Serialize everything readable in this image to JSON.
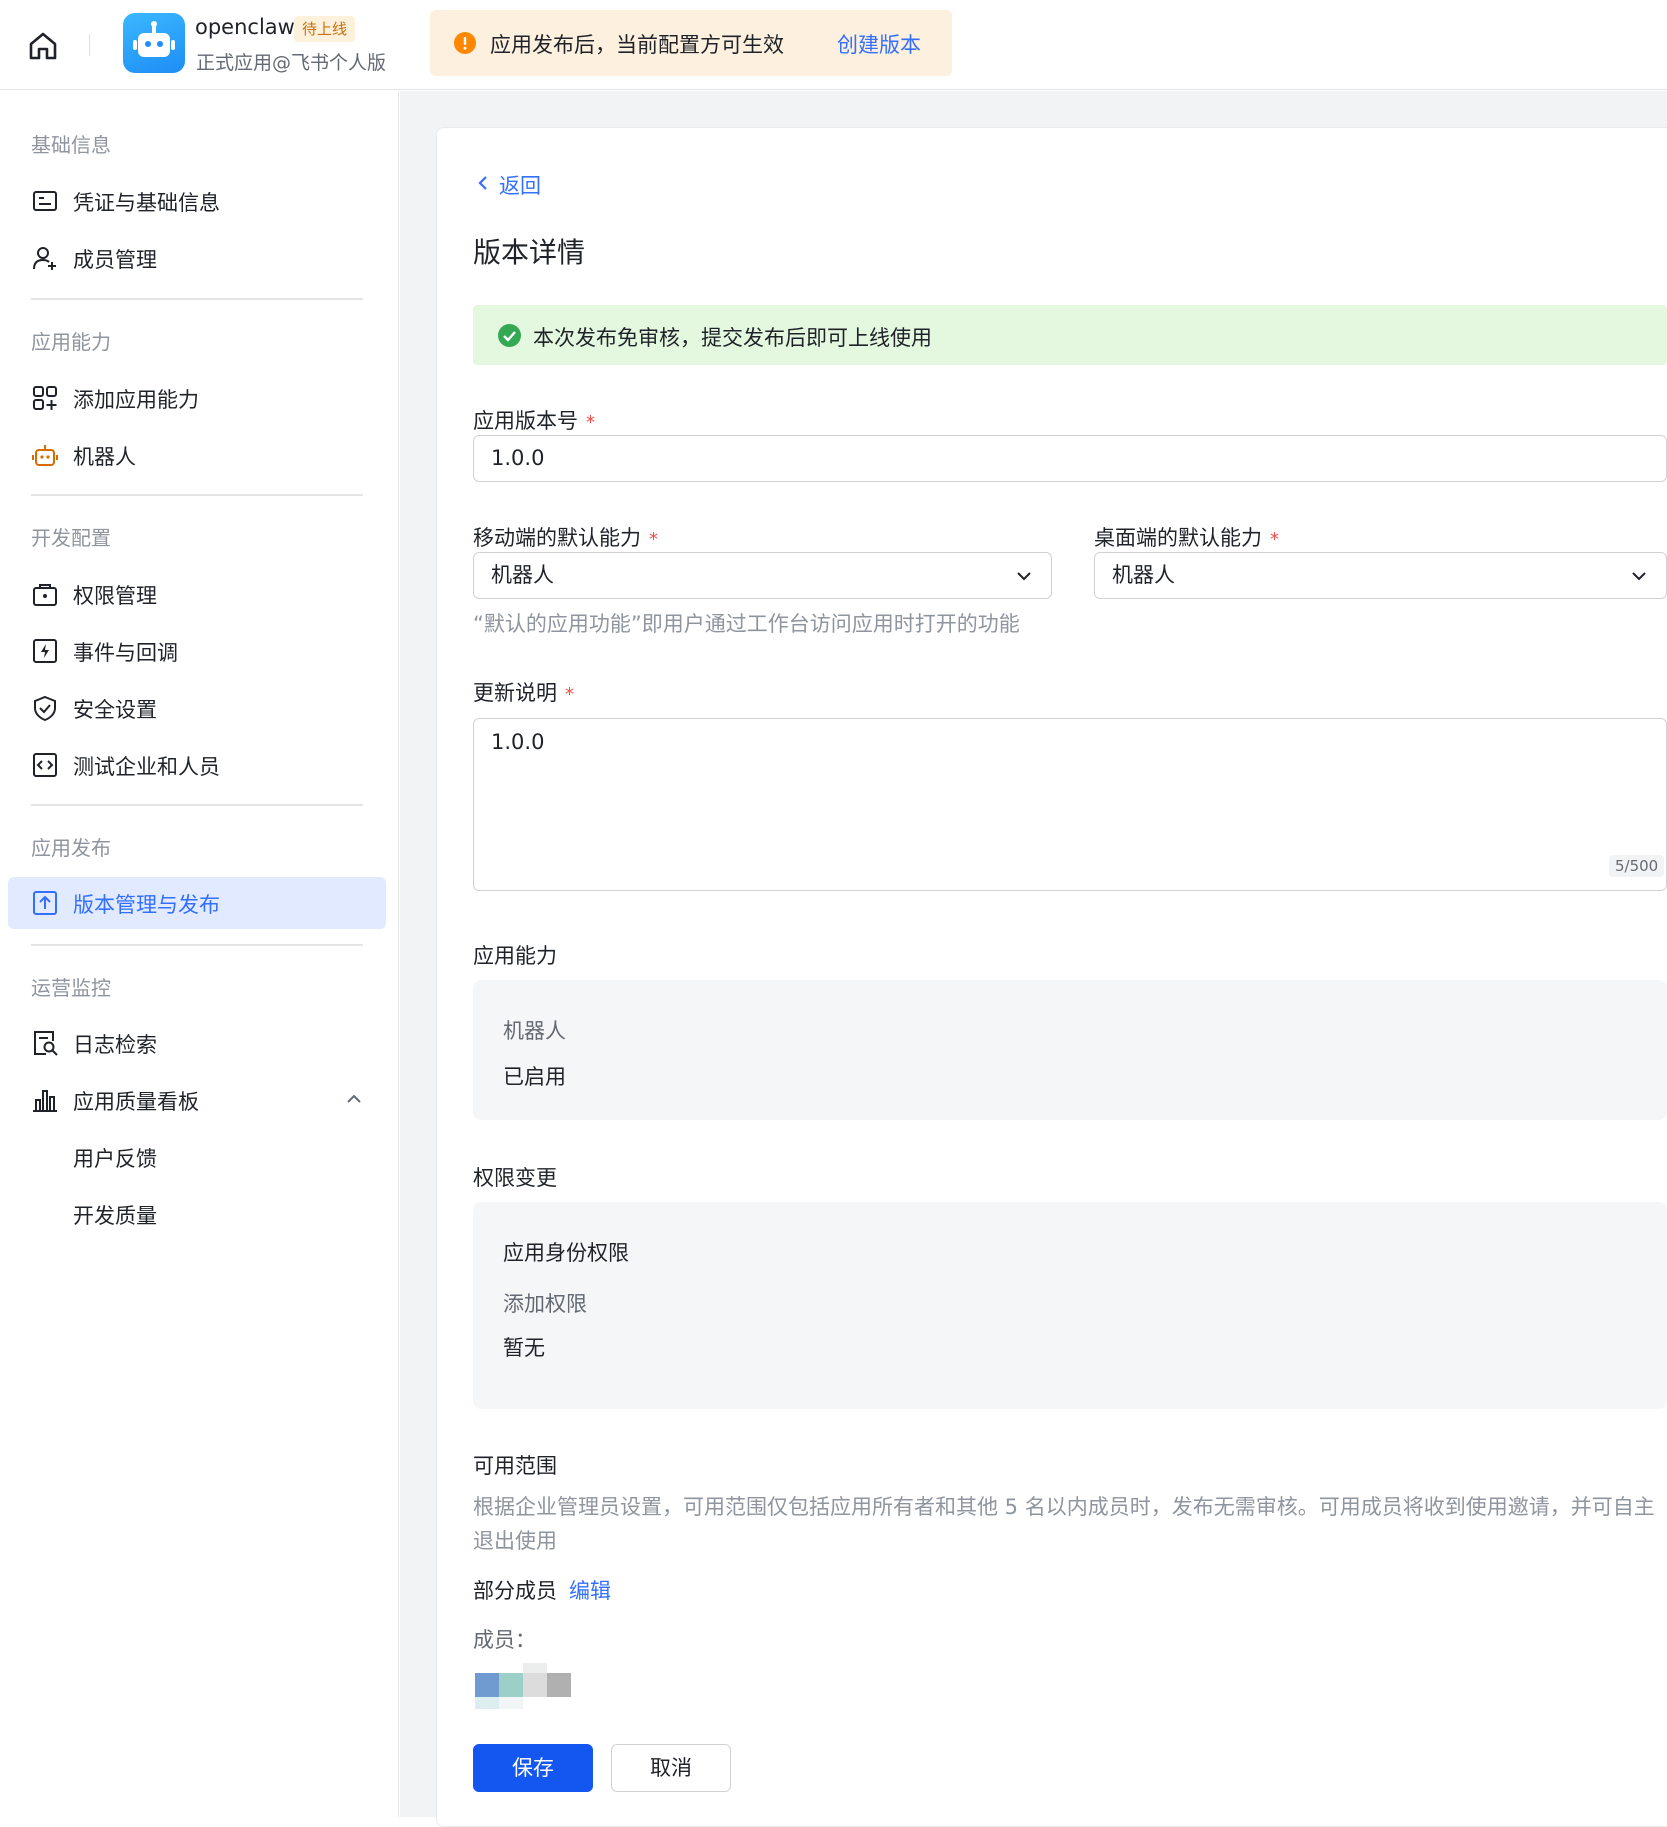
{
  "header": {
    "app_name": "openclaw",
    "status_badge": "待上线",
    "app_subtitle": "正式应用@飞书个人版",
    "notice_text": "应用发布后，当前配置方可生效",
    "notice_link": "创建版本"
  },
  "sidebar": {
    "sections": [
      {
        "title": "基础信息",
        "items": [
          {
            "label": "凭证与基础信息",
            "icon": "id-card-icon"
          },
          {
            "label": "成员管理",
            "icon": "add-user-icon"
          }
        ]
      },
      {
        "title": "应用能力",
        "items": [
          {
            "label": "添加应用能力",
            "icon": "apps-add-icon"
          },
          {
            "label": "机器人",
            "icon": "robot-icon"
          }
        ]
      },
      {
        "title": "开发配置",
        "items": [
          {
            "label": "权限管理",
            "icon": "lock-bag-icon"
          },
          {
            "label": "事件与回调",
            "icon": "event-icon"
          },
          {
            "label": "安全设置",
            "icon": "shield-check-icon"
          },
          {
            "label": "测试企业和人员",
            "icon": "code-icon"
          }
        ]
      },
      {
        "title": "应用发布",
        "items": [
          {
            "label": "版本管理与发布",
            "icon": "upload-icon",
            "active": true
          }
        ]
      },
      {
        "title": "运营监控",
        "items": [
          {
            "label": "日志检索",
            "icon": "log-search-icon"
          },
          {
            "label": "应用质量看板",
            "icon": "bar-chart-icon",
            "expanded": true
          },
          {
            "label": "用户反馈"
          },
          {
            "label": "开发质量"
          }
        ]
      }
    ]
  },
  "main": {
    "back_label": "返回",
    "title": "版本详情",
    "success_text": "本次发布免审核，提交发布后即可上线使用",
    "version_field": {
      "label": "应用版本号",
      "required_mark": "*",
      "value": "1.0.0"
    },
    "mobile_default": {
      "label": "移动端的默认能力",
      "required_mark": "*",
      "value": "机器人"
    },
    "desktop_default": {
      "label": "桌面端的默认能力",
      "required_mark": "*",
      "value": "机器人"
    },
    "default_helper": "“默认的应用功能”即用户通过工作台访问应用时打开的功能",
    "update_notes": {
      "label": "更新说明",
      "required_mark": "*",
      "value": "1.0.0",
      "counter": "5/500"
    },
    "capability": {
      "section_title": "应用能力",
      "name": "机器人",
      "status": "已启用"
    },
    "permissions": {
      "section_title": "权限变更",
      "group": "应用身份权限",
      "sub_label": "添加权限",
      "value": "暂无"
    },
    "scope": {
      "section_title": "可用范围",
      "description": "根据企业管理员设置，可用范围仅包括应用所有者和其他 5 名以内成员时，发布无需审核。可用成员将收到使用邀请，并可自主退出使用",
      "mode": "部分成员",
      "edit_label": "编辑",
      "members_label": "成员："
    },
    "buttons": {
      "save": "保存",
      "cancel": "取消"
    }
  },
  "colors": {
    "accent": "#3370ff",
    "primary_button": "#1456f0",
    "success_bg": "#e4f8df",
    "notice_bg": "#fdf0df"
  }
}
